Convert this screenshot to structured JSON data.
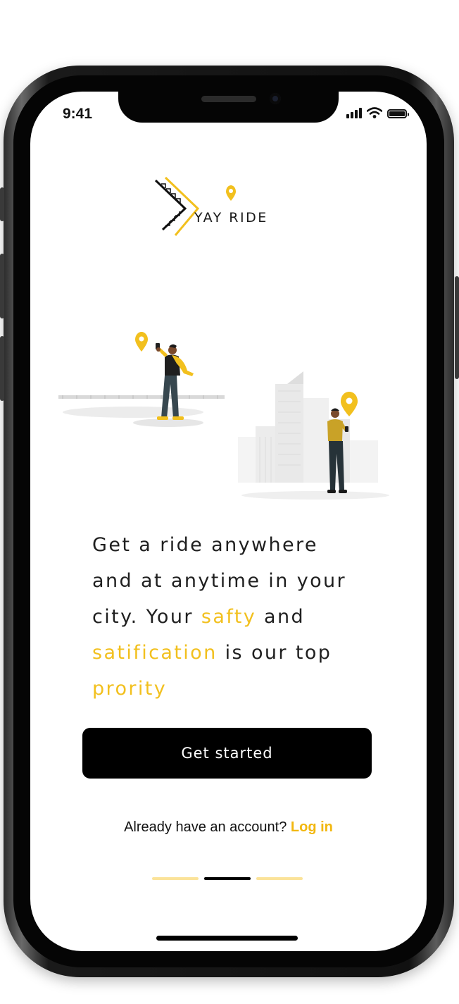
{
  "status_bar": {
    "time": "9:41"
  },
  "app": {
    "name": "YAY RIDE"
  },
  "onboarding": {
    "headline_parts": [
      {
        "text": "Get a ride anywhere\nand at anytime in your\ncity. Your ",
        "highlight": false
      },
      {
        "text": "safty",
        "highlight": true
      },
      {
        "text": " and\n",
        "highlight": false
      },
      {
        "text": "satification",
        "highlight": true
      },
      {
        "text": " is our top\n",
        "highlight": false
      },
      {
        "text": "prority",
        "highlight": true
      }
    ],
    "cta_label": "Get started",
    "account_prompt": "Already have an account?",
    "login_label": "Log in",
    "pages": {
      "count": 3,
      "active_index": 1
    }
  },
  "colors": {
    "accent": "#f2c01e",
    "accent_light": "#fbe39a",
    "text": "#1f1f1f",
    "button": "#000000"
  },
  "icons": [
    "signal-icon",
    "wifi-icon",
    "battery-icon",
    "location-pin-icon"
  ]
}
